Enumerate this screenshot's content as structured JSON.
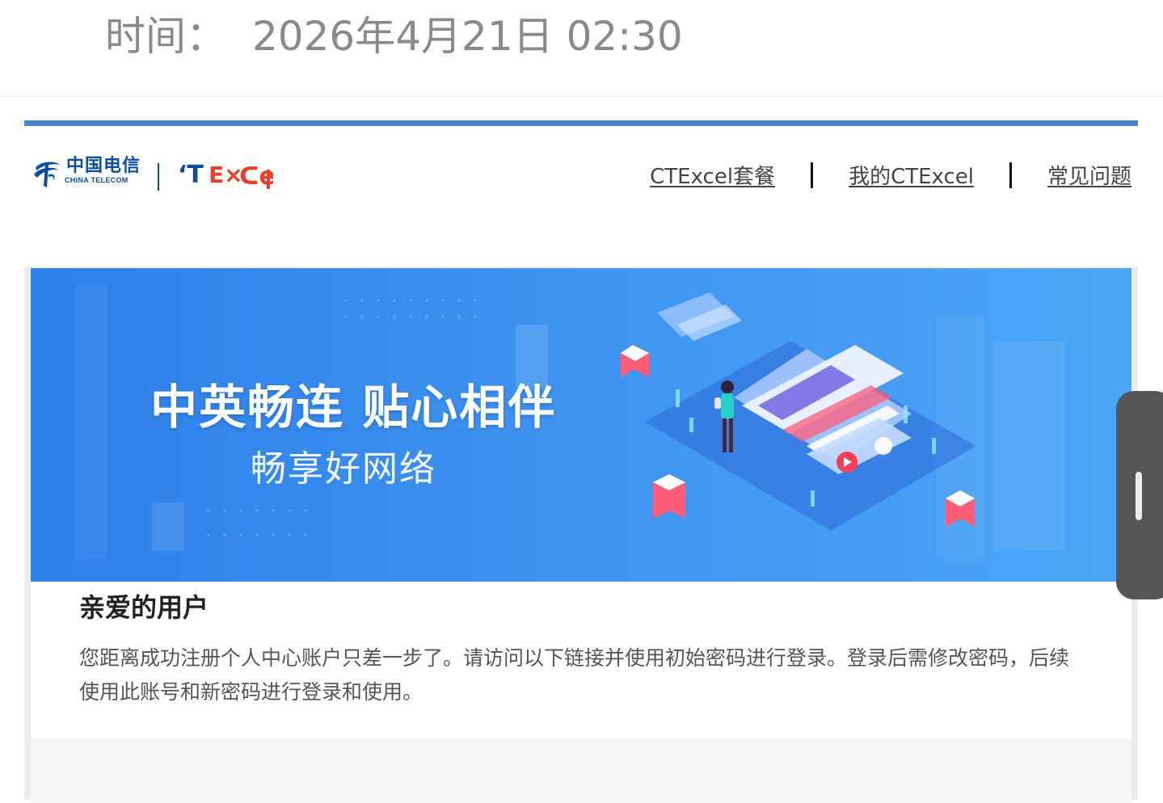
{
  "status_bar": {
    "time_label": "时间：",
    "time_value": "2026年4月21日 02:30"
  },
  "header": {
    "logo_cn": "中国电信",
    "logo_en": "CHINA TELECOM",
    "brand_logo": "CTExcel",
    "nav": [
      {
        "label": "CTExcel套餐"
      },
      {
        "label": "我的CTExcel"
      },
      {
        "label": "常见问题"
      }
    ]
  },
  "banner": {
    "title": "中英畅连 贴心相伴",
    "subtitle": "畅享好网络",
    "illustration": "person-with-phone-isometric"
  },
  "content": {
    "greeting": "亲爱的用户",
    "message": "您距离成功注册个人中心账户只差一步了。请访问以下链接并使用初始密码进行登录。登录后需修改密码，后续使用此账号和新密码进行登录和使用。"
  },
  "colors": {
    "accent": "#4a86cc",
    "brand_blue": "#0b4fa0",
    "brand_red": "#e8402a",
    "banner_blue": "#3d92f0"
  }
}
